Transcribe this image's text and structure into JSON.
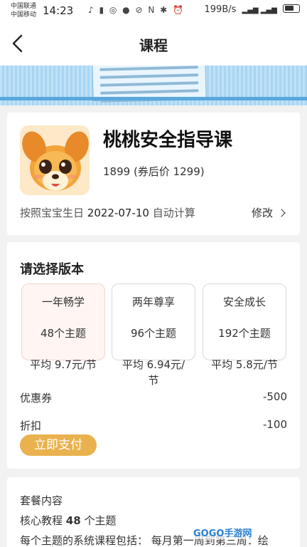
{
  "status_bar": {
    "carrier_1": "中国联通",
    "carrier_2": "中国移动",
    "time": "14:23",
    "icons": "♪ ▮ ◎ ● ⊘ N ✱ ⏰",
    "speed": "199B/s",
    "signal": "WiFi 4G 5G"
  },
  "navbar": {
    "title": "课程",
    "back_icon": "chevron-left"
  },
  "course": {
    "title": "桃桃安全指导课",
    "price": "1899 (券后价 1299)",
    "birth_prefix": "按照宝宝生日",
    "birth_date": "2022-07-10",
    "birth_suffix": "自动计算",
    "edit_label": "修改"
  },
  "version": {
    "title": "请选择版本",
    "plans": [
      {
        "name": "一年畅学",
        "topics": "48个主题",
        "avg": "平均 9.7元/节",
        "selected": true
      },
      {
        "name": "两年尊享",
        "topics": "96个主题",
        "avg": "平均 6.94元/节",
        "selected": false
      },
      {
        "name": "安全成长",
        "topics": "192个主题",
        "avg": "平均 5.8元/节",
        "selected": false
      }
    ],
    "coupon_label": "优惠券",
    "coupon_value": "-500",
    "discount_label": "折扣",
    "discount_value": "-100",
    "pay_label": "立即支付"
  },
  "package": {
    "title": "套餐内容",
    "core_prefix": "核心教程",
    "core_count": "48",
    "core_suffix": "个主题",
    "detail": "每个主题的系统课程包括： 每月第一周到第三周：绘"
  },
  "watermark": "GOGO手游网",
  "colors": {
    "accent": "#e9b24e",
    "selected_bg": "#fff6f3",
    "selected_border": "#f5d4cc",
    "banner": "#a8d5f2"
  }
}
